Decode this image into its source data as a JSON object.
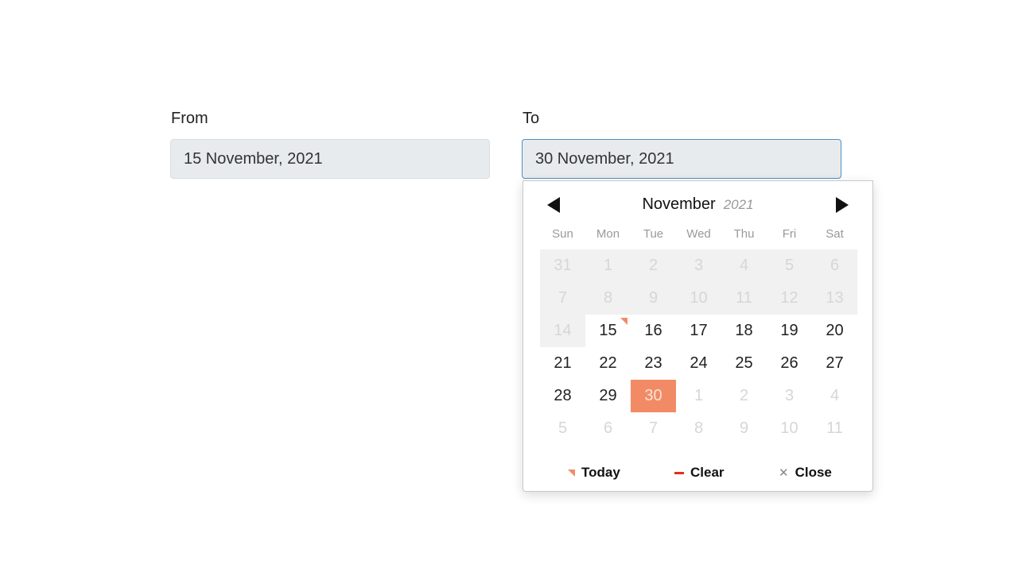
{
  "from": {
    "label": "From",
    "value": "15 November, 2021"
  },
  "to": {
    "label": "To",
    "value": "30 November, 2021"
  },
  "picker": {
    "month": "November",
    "year": "2021",
    "prev_icon": "triangle-left-icon",
    "next_icon": "triangle-right-icon",
    "weekdays": [
      "Sun",
      "Mon",
      "Tue",
      "Wed",
      "Thu",
      "Fri",
      "Sat"
    ],
    "weeks": [
      [
        {
          "d": "31",
          "s": "disabled"
        },
        {
          "d": "1",
          "s": "disabled"
        },
        {
          "d": "2",
          "s": "disabled"
        },
        {
          "d": "3",
          "s": "disabled"
        },
        {
          "d": "4",
          "s": "disabled"
        },
        {
          "d": "5",
          "s": "disabled"
        },
        {
          "d": "6",
          "s": "disabled"
        }
      ],
      [
        {
          "d": "7",
          "s": "disabled"
        },
        {
          "d": "8",
          "s": "disabled"
        },
        {
          "d": "9",
          "s": "disabled"
        },
        {
          "d": "10",
          "s": "disabled"
        },
        {
          "d": "11",
          "s": "disabled"
        },
        {
          "d": "12",
          "s": "disabled"
        },
        {
          "d": "13",
          "s": "disabled"
        }
      ],
      [
        {
          "d": "14",
          "s": "disabled"
        },
        {
          "d": "15",
          "s": "today"
        },
        {
          "d": "16",
          "s": ""
        },
        {
          "d": "17",
          "s": ""
        },
        {
          "d": "18",
          "s": ""
        },
        {
          "d": "19",
          "s": ""
        },
        {
          "d": "20",
          "s": ""
        }
      ],
      [
        {
          "d": "21",
          "s": ""
        },
        {
          "d": "22",
          "s": ""
        },
        {
          "d": "23",
          "s": ""
        },
        {
          "d": "24",
          "s": ""
        },
        {
          "d": "25",
          "s": ""
        },
        {
          "d": "26",
          "s": ""
        },
        {
          "d": "27",
          "s": ""
        }
      ],
      [
        {
          "d": "28",
          "s": ""
        },
        {
          "d": "29",
          "s": ""
        },
        {
          "d": "30",
          "s": "selected"
        },
        {
          "d": "1",
          "s": "outside"
        },
        {
          "d": "2",
          "s": "outside"
        },
        {
          "d": "3",
          "s": "outside"
        },
        {
          "d": "4",
          "s": "outside"
        }
      ],
      [
        {
          "d": "5",
          "s": "outside"
        },
        {
          "d": "6",
          "s": "outside"
        },
        {
          "d": "7",
          "s": "outside"
        },
        {
          "d": "8",
          "s": "outside"
        },
        {
          "d": "9",
          "s": "outside"
        },
        {
          "d": "10",
          "s": "outside"
        },
        {
          "d": "11",
          "s": "outside"
        }
      ]
    ],
    "footer": {
      "today": {
        "label": "Today",
        "icon": "today-marker-icon"
      },
      "clear": {
        "label": "Clear",
        "icon": "minus-icon"
      },
      "close": {
        "label": "Close",
        "icon": "close-icon",
        "glyph": "✕"
      }
    }
  },
  "colors": {
    "accent": "#f28b65",
    "clear": "#e0301e",
    "focus_border": "#4a90c8",
    "input_bg": "#e8ebee"
  }
}
